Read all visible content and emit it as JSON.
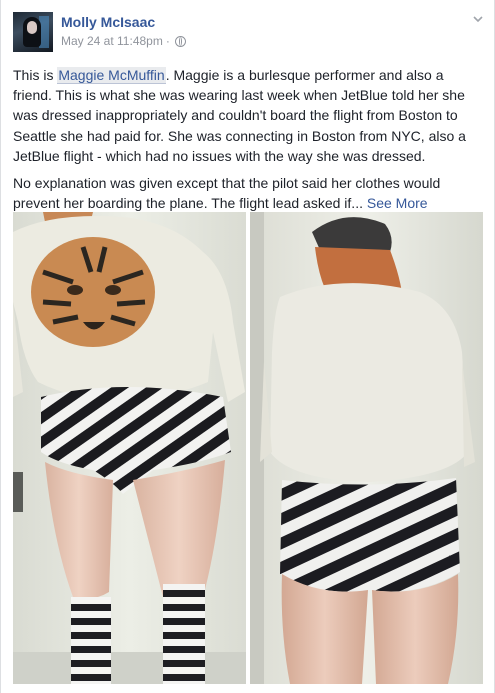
{
  "post": {
    "author": "Molly McIsaac",
    "timestamp": "May 24 at 11:48pm",
    "separator": "·",
    "privacy_icon": "globe-icon",
    "menu_icon": "chevron-down-icon",
    "paragraph1_before": "This is ",
    "mention": "Maggie McMuffin",
    "paragraph1_after": ". Maggie is a burlesque performer and also a friend. This is what she was wearing last week when JetBlue told her she was dressed inappropriately and couldn't board the flight from Boston to Seattle she had paid for. She was connecting in Boston from NYC, also a JetBlue flight - which had no issues with the way she was dressed.",
    "paragraph2": "No explanation was given except that the pilot said her clothes would prevent her boarding the plane. The flight lead asked if...",
    "see_more": "See More"
  },
  "colors": {
    "link": "#365899",
    "text": "#1d2129",
    "meta": "#90949c"
  }
}
